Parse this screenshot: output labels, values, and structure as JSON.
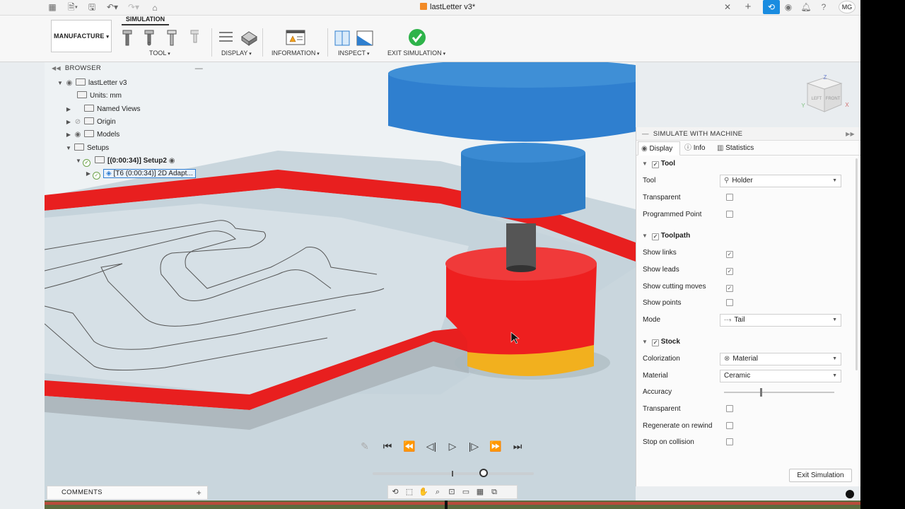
{
  "window": {
    "title": "lastLetter v3*",
    "user_initials": "MG",
    "icons": [
      "grid-icon",
      "file-icon",
      "save-icon",
      "undo-icon",
      "redo-icon",
      "home-icon",
      "close-icon",
      "add-tab-icon",
      "sync-icon",
      "online-icon",
      "notifications-icon",
      "help-icon"
    ]
  },
  "toolbar": {
    "workspace": "MANUFACTURE",
    "active_tab": "SIMULATION",
    "groups": [
      {
        "label": "TOOL"
      },
      {
        "label": "DISPLAY"
      },
      {
        "label": "INFORMATION"
      },
      {
        "label": "INSPECT"
      },
      {
        "label": "EXIT SIMULATION"
      }
    ]
  },
  "browser": {
    "title": "BROWSER",
    "items": [
      {
        "label": "lastLetter v3"
      },
      {
        "label": "Units: mm"
      },
      {
        "label": "Named Views"
      },
      {
        "label": "Origin"
      },
      {
        "label": "Models"
      },
      {
        "label": "Setups"
      },
      {
        "label": "[(0:00:34)] Setup2"
      },
      {
        "label": "[T6 (0:00:34)] 2D Adapt..."
      }
    ]
  },
  "viewcube": {
    "top": "Z",
    "left": "LEFT",
    "front": "FRONT",
    "x": "X",
    "y": "Y"
  },
  "sim_panel": {
    "title": "SIMULATE WITH MACHINE",
    "tabs": [
      "Display",
      "Info",
      "Statistics"
    ],
    "sections": {
      "tool": {
        "title": "Tool",
        "tool_label": "Tool",
        "tool_value": "Holder",
        "transparent_label": "Transparent",
        "programmed_point_label": "Programmed Point"
      },
      "toolpath": {
        "title": "Toolpath",
        "show_links": "Show links",
        "show_leads": "Show leads",
        "show_cutting_moves": "Show cutting moves",
        "show_points": "Show points",
        "mode_label": "Mode",
        "mode_value": "Tail"
      },
      "stock": {
        "title": "Stock",
        "colorization_label": "Colorization",
        "colorization_value": "Material",
        "material_label": "Material",
        "material_value": "Ceramic",
        "accuracy_label": "Accuracy",
        "accuracy_level": 0.33,
        "transparent_label": "Transparent",
        "regenerate_label": "Regenerate on rewind",
        "stop_label": "Stop on collision"
      }
    },
    "checks": {
      "tool_section": true,
      "tool_transparent": false,
      "programmed_point": false,
      "toolpath_section": true,
      "show_links": true,
      "show_leads": true,
      "show_cutting_moves": true,
      "show_points": false,
      "stock_section": true,
      "stock_transparent": false,
      "regenerate": false,
      "stop_on_collision": false
    },
    "exit_button": "Exit Simulation"
  },
  "playback": {
    "position": 0.69
  },
  "comments": {
    "title": "COMMENTS"
  },
  "colors": {
    "spindle": "#2f7fcf",
    "holder": "#ee1f1f",
    "cutter_tip": "#f2b01e",
    "stock": "#c5d3db",
    "toolpath_edge": "#e81f1f"
  }
}
